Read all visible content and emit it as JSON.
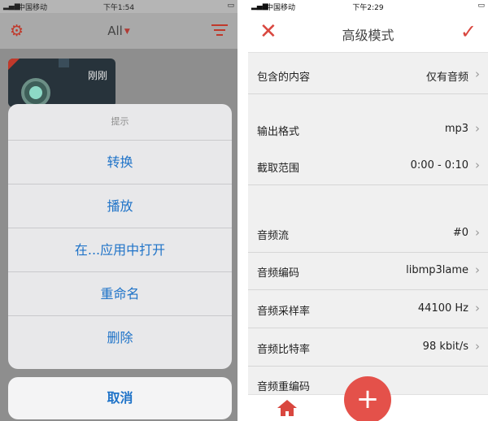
{
  "left_phone": {
    "status": {
      "carrier": "中国移动",
      "time": "下午1:54"
    },
    "header": {
      "filter_label": "All"
    },
    "card": {
      "time_label": "刚刚"
    },
    "action_sheet": {
      "title": "提示",
      "actions": [
        "转换",
        "播放",
        "在...应用中打开",
        "重命名",
        "删除"
      ],
      "cancel": "取消"
    }
  },
  "right_phone": {
    "status": {
      "carrier": "中国移动",
      "time": "下午2:29"
    },
    "header": {
      "title": "高级模式"
    },
    "rows": [
      {
        "label": "包含的内容",
        "value": "仅有音频"
      },
      {
        "label": "输出格式",
        "value": "mp3"
      },
      {
        "label": "截取范围",
        "value": "0:00 - 0:10"
      },
      {
        "label": "音频流",
        "value": "#0"
      },
      {
        "label": "音频编码",
        "value": "libmp3lame"
      },
      {
        "label": "音频采样率",
        "value": "44100 Hz"
      },
      {
        "label": "音频比特率",
        "value": "98 kbit/s"
      },
      {
        "label": "音频重编码",
        "value": ""
      }
    ]
  },
  "colors": {
    "accent": "#d9473f",
    "ios_blue": "#1f73c8"
  }
}
